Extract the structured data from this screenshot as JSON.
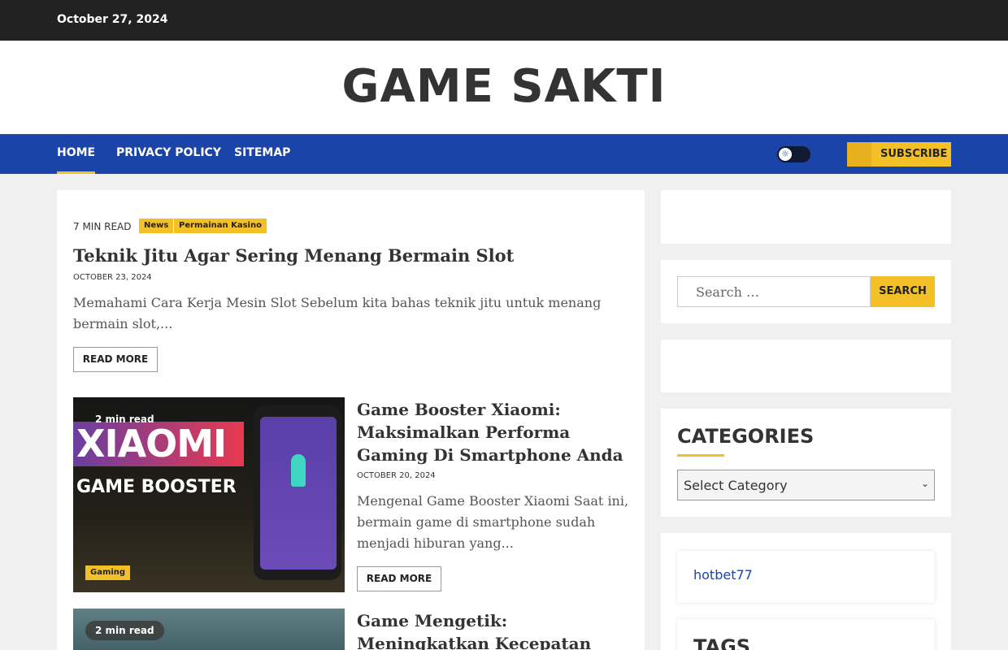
{
  "topbar": {
    "date": "October 27, 2024"
  },
  "site": {
    "title": "GAME SAKTI"
  },
  "nav": {
    "items": [
      "HOME",
      "PRIVACY POLICY",
      "SITEMAP"
    ],
    "theme_toggle_icon": "sun-icon",
    "subscribe_label": "SUBSCRIBE"
  },
  "featured_post": {
    "read_time": "7 MIN READ",
    "tags": [
      "News",
      "Permainan Kasino"
    ],
    "title": "Teknik Jitu Agar Sering Menang Bermain Slot",
    "date": "OCTOBER 23, 2024",
    "excerpt": "Memahami Cara Kerja Mesin Slot Sebelum kita bahas teknik jitu untuk menang bermain slot,...",
    "read_more": "READ MORE"
  },
  "posts": [
    {
      "read_time": "2 min read",
      "category": "Gaming",
      "thumb_line1": "XIAOMI",
      "thumb_line2": "GAME BOOSTER",
      "title": "Game Booster Xiaomi: Maksimalkan Performa Gaming Di Smartphone Anda",
      "date": "OCTOBER 20, 2024",
      "excerpt": "Mengenal Game Booster Xiaomi Saat ini, bermain game di smartphone sudah menjadi hiburan yang...",
      "read_more": "READ MORE"
    },
    {
      "read_time": "2 min read",
      "title": "Game Mengetik: Meningkatkan Kecepatan Mengetik Sambil"
    }
  ],
  "sidebar": {
    "search": {
      "placeholder": "Search …",
      "button": "SEARCH"
    },
    "categories": {
      "title": "CATEGORIES",
      "selected": "Select Category"
    },
    "links": [
      "hotbet77"
    ],
    "tags_title": "TAGS"
  },
  "colors": {
    "accent": "#f4c028",
    "nav": "#1b44a8",
    "topbar": "#222222"
  }
}
